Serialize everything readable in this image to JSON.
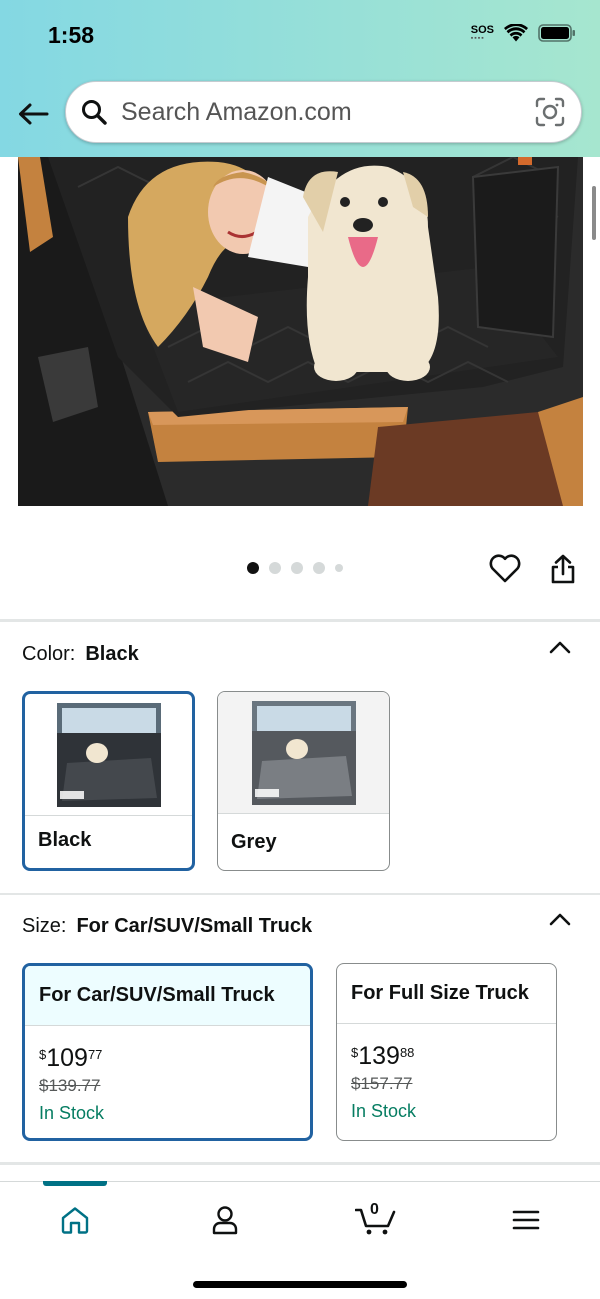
{
  "status_bar": {
    "time": "1:58",
    "sos": "SOS"
  },
  "search": {
    "placeholder": "Search Amazon.com"
  },
  "product_image": {
    "alt": "Woman and dog lying on black back seat extender in car",
    "carousel_count": 5,
    "carousel_active_index": 0
  },
  "color_section": {
    "label": "Color:",
    "selected": "Black",
    "options": [
      {
        "name": "Black"
      },
      {
        "name": "Grey"
      }
    ]
  },
  "size_section": {
    "label": "Size:",
    "selected": "For Car/SUV/Small Truck",
    "options": [
      {
        "title": "For Car/SUV/Small Truck",
        "price_dollar": "$",
        "price_whole": "109",
        "price_fraction": "77",
        "list_price": "$139.77",
        "stock": "In Stock"
      },
      {
        "title": "For Full Size Truck",
        "price_dollar": "$",
        "price_whole": "139",
        "price_fraction": "88",
        "list_price": "$157.77",
        "stock": "In Stock"
      }
    ]
  },
  "bottom_nav": {
    "items": [
      {
        "name": "home",
        "icon": "home-icon"
      },
      {
        "name": "account",
        "icon": "person-icon"
      },
      {
        "name": "cart",
        "icon": "cart-icon"
      },
      {
        "name": "menu",
        "icon": "hamburger-icon"
      }
    ],
    "cart_count": "0",
    "active": "home"
  },
  "colors": {
    "accent_blue": "#2162a1",
    "teal": "#007185",
    "in_stock_green": "#067d62",
    "header_start": "#84d8e3",
    "header_end": "#a6e6cf"
  }
}
